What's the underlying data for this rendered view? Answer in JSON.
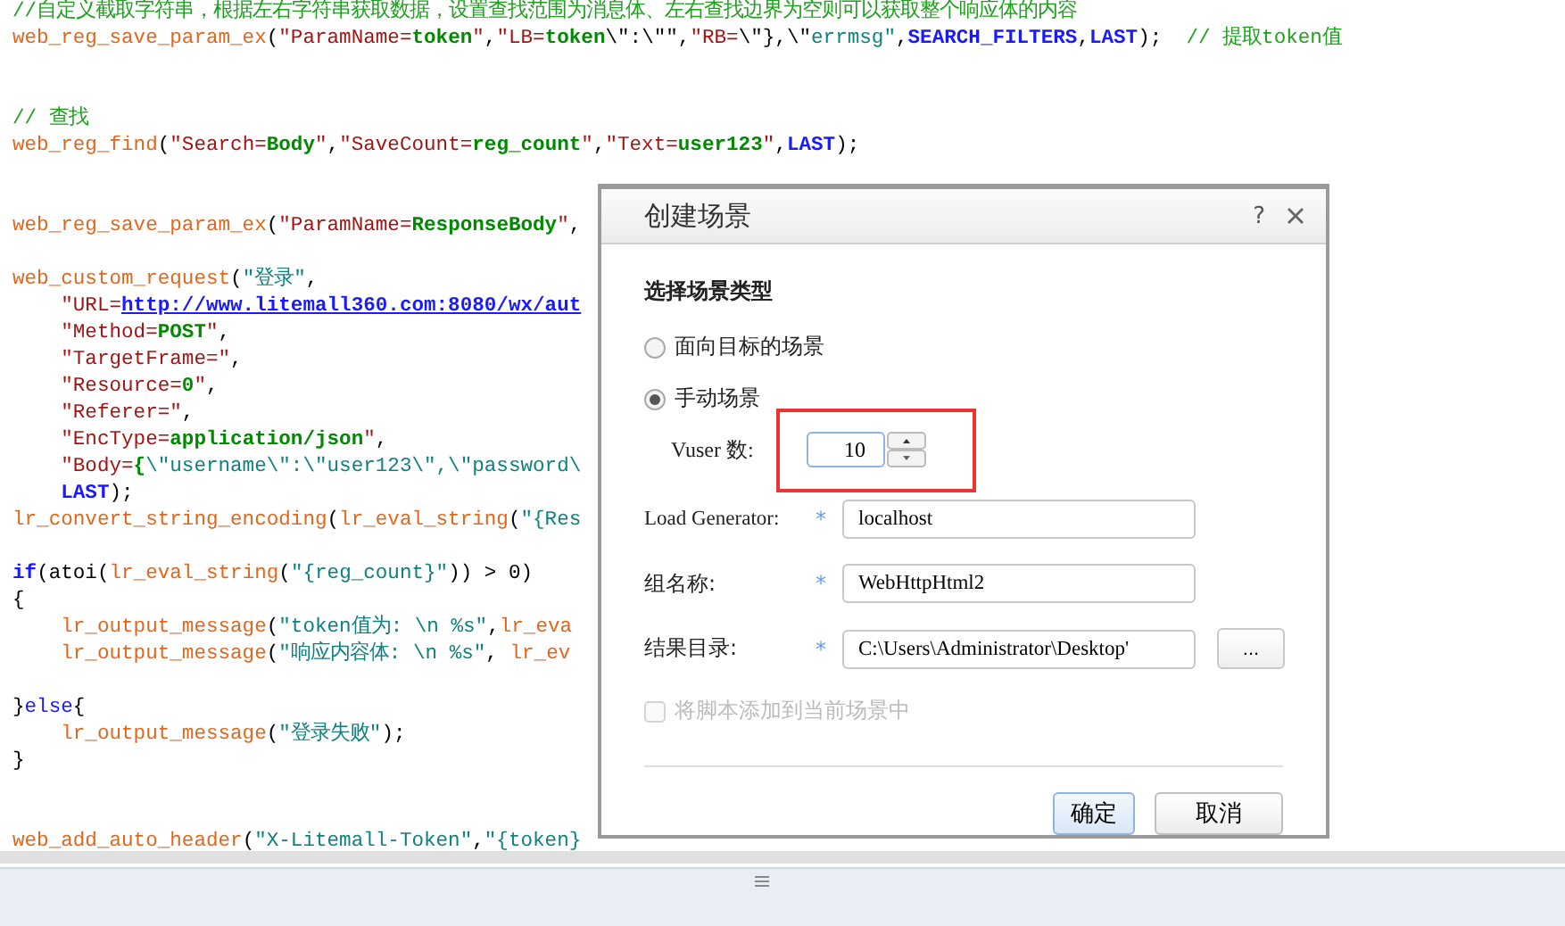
{
  "editor": {
    "lines": [
      {
        "kind": "code",
        "tokens": [
          {
            "kind": "c",
            "text": "//自定义截取字符串，根据左右字符串获取数据，设置查找范围为消息体、左右查找边界为空则可以获取整个响应体的内容"
          }
        ]
      },
      {
        "kind": "code",
        "tokens": [
          {
            "kind": "f",
            "text": "web_reg_save_param_ex"
          },
          {
            "kind": "p",
            "text": "("
          },
          {
            "kind": "s",
            "text": "\"ParamName="
          },
          {
            "kind": "v",
            "text": "token"
          },
          {
            "kind": "s",
            "text": "\""
          },
          {
            "kind": "p",
            "text": ","
          },
          {
            "kind": "s",
            "text": "\"LB="
          },
          {
            "kind": "v",
            "text": "token"
          },
          {
            "kind": "p",
            "text": "\\\":\\\"\""
          },
          {
            "kind": "p",
            "text": ","
          },
          {
            "kind": "s",
            "text": "\"RB="
          },
          {
            "kind": "p",
            "text": "\\\"},\\\""
          },
          {
            "kind": "t",
            "text": "errmsg\""
          },
          {
            "kind": "p",
            "text": ","
          },
          {
            "kind": "k",
            "text": "SEARCH_FILTERS"
          },
          {
            "kind": "p",
            "text": ","
          },
          {
            "kind": "k",
            "text": "LAST"
          },
          {
            "kind": "p",
            "text": ");  "
          },
          {
            "kind": "c",
            "text": "// 提取token值"
          }
        ]
      },
      {
        "kind": "blank"
      },
      {
        "kind": "blank"
      },
      {
        "kind": "code",
        "tokens": [
          {
            "kind": "c",
            "text": "// 查找"
          }
        ]
      },
      {
        "kind": "code",
        "tokens": [
          {
            "kind": "f",
            "text": "web_reg_find"
          },
          {
            "kind": "p",
            "text": "("
          },
          {
            "kind": "s",
            "text": "\"Search="
          },
          {
            "kind": "v",
            "text": "Body"
          },
          {
            "kind": "s",
            "text": "\""
          },
          {
            "kind": "p",
            "text": ","
          },
          {
            "kind": "s",
            "text": "\"SaveCount="
          },
          {
            "kind": "v",
            "text": "reg_count"
          },
          {
            "kind": "s",
            "text": "\""
          },
          {
            "kind": "p",
            "text": ","
          },
          {
            "kind": "s",
            "text": "\"Text="
          },
          {
            "kind": "v",
            "text": "user123"
          },
          {
            "kind": "s",
            "text": "\""
          },
          {
            "kind": "p",
            "text": ","
          },
          {
            "kind": "k",
            "text": "LAST"
          },
          {
            "kind": "p",
            "text": ");"
          }
        ]
      },
      {
        "kind": "blank"
      },
      {
        "kind": "blank"
      },
      {
        "kind": "code",
        "tokens": [
          {
            "kind": "f",
            "text": "web_reg_save_param_ex"
          },
          {
            "kind": "p",
            "text": "("
          },
          {
            "kind": "s",
            "text": "\"ParamName="
          },
          {
            "kind": "v",
            "text": "ResponseBody"
          },
          {
            "kind": "s",
            "text": "\""
          },
          {
            "kind": "p",
            "text": ","
          }
        ]
      },
      {
        "kind": "blank"
      },
      {
        "kind": "code",
        "tokens": [
          {
            "kind": "f",
            "text": "web_custom_request"
          },
          {
            "kind": "p",
            "text": "("
          },
          {
            "kind": "t",
            "text": "\"登录\""
          },
          {
            "kind": "p",
            "text": ","
          }
        ]
      },
      {
        "kind": "code",
        "tokens": [
          {
            "kind": "s",
            "text": "    \"URL="
          },
          {
            "kind": "u",
            "text": "http://www.litemall360.com:8080/wx/aut"
          }
        ]
      },
      {
        "kind": "code",
        "tokens": [
          {
            "kind": "s",
            "text": "    \"Method="
          },
          {
            "kind": "v",
            "text": "POST"
          },
          {
            "kind": "s",
            "text": "\""
          },
          {
            "kind": "p",
            "text": ","
          }
        ]
      },
      {
        "kind": "code",
        "tokens": [
          {
            "kind": "s",
            "text": "    \"TargetFrame=\""
          },
          {
            "kind": "p",
            "text": ","
          }
        ]
      },
      {
        "kind": "code",
        "tokens": [
          {
            "kind": "s",
            "text": "    \"Resource="
          },
          {
            "kind": "v",
            "text": "0"
          },
          {
            "kind": "s",
            "text": "\""
          },
          {
            "kind": "p",
            "text": ","
          }
        ]
      },
      {
        "kind": "code",
        "tokens": [
          {
            "kind": "s",
            "text": "    \"Referer=\""
          },
          {
            "kind": "p",
            "text": ","
          }
        ]
      },
      {
        "kind": "code",
        "tokens": [
          {
            "kind": "s",
            "text": "    \"EncType="
          },
          {
            "kind": "v",
            "text": "application/json"
          },
          {
            "kind": "s",
            "text": "\""
          },
          {
            "kind": "p",
            "text": ","
          }
        ]
      },
      {
        "kind": "code",
        "tokens": [
          {
            "kind": "s",
            "text": "    \"Body="
          },
          {
            "kind": "v",
            "text": "{"
          },
          {
            "kind": "t",
            "text": "\\\"username\\\":\\\"user123\\\",\\\"password\\"
          }
        ]
      },
      {
        "kind": "code",
        "tokens": [
          {
            "kind": "k",
            "text": "    LAST"
          },
          {
            "kind": "p",
            "text": ");"
          }
        ]
      },
      {
        "kind": "code",
        "tokens": [
          {
            "kind": "f",
            "text": "lr_convert_string_encoding"
          },
          {
            "kind": "p",
            "text": "("
          },
          {
            "kind": "f",
            "text": "lr_eval_string"
          },
          {
            "kind": "p",
            "text": "("
          },
          {
            "kind": "t",
            "text": "\"{Res"
          }
        ]
      },
      {
        "kind": "blank"
      },
      {
        "kind": "code",
        "tokens": [
          {
            "kind": "k",
            "text": "if"
          },
          {
            "kind": "p",
            "text": "(atoi("
          },
          {
            "kind": "f",
            "text": "lr_eval_string"
          },
          {
            "kind": "p",
            "text": "("
          },
          {
            "kind": "t",
            "text": "\"{reg_count}\""
          },
          {
            "kind": "p",
            "text": ")) > 0)"
          }
        ]
      },
      {
        "kind": "code",
        "tokens": [
          {
            "kind": "p",
            "text": "{"
          }
        ]
      },
      {
        "kind": "code",
        "tokens": [
          {
            "kind": "f",
            "text": "    lr_output_message"
          },
          {
            "kind": "p",
            "text": "("
          },
          {
            "kind": "t",
            "text": "\"token值为: \\n %s\""
          },
          {
            "kind": "p",
            "text": ","
          },
          {
            "kind": "f",
            "text": "lr_eva"
          }
        ]
      },
      {
        "kind": "code",
        "tokens": [
          {
            "kind": "f",
            "text": "    lr_output_message"
          },
          {
            "kind": "p",
            "text": "("
          },
          {
            "kind": "t",
            "text": "\"响应内容体: \\n %s\""
          },
          {
            "kind": "p",
            "text": ", "
          },
          {
            "kind": "f",
            "text": "lr_ev"
          }
        ]
      },
      {
        "kind": "blank"
      },
      {
        "kind": "code",
        "tokens": [
          {
            "kind": "p",
            "text": "}"
          },
          {
            "kind": "e",
            "text": "else"
          },
          {
            "kind": "p",
            "text": "{"
          }
        ]
      },
      {
        "kind": "code",
        "tokens": [
          {
            "kind": "f",
            "text": "    lr_output_message"
          },
          {
            "kind": "p",
            "text": "("
          },
          {
            "kind": "t",
            "text": "\"登录失败\""
          },
          {
            "kind": "p",
            "text": ");"
          }
        ]
      },
      {
        "kind": "code",
        "tokens": [
          {
            "kind": "p",
            "text": "}"
          }
        ]
      },
      {
        "kind": "blank"
      },
      {
        "kind": "blank"
      },
      {
        "kind": "code",
        "tokens": [
          {
            "kind": "f",
            "text": "web_add_auto_header"
          },
          {
            "kind": "p",
            "text": "("
          },
          {
            "kind": "t",
            "text": "\"X-Litemall-Token\""
          },
          {
            "kind": "p",
            "text": ","
          },
          {
            "kind": "t",
            "text": "\"{token}"
          }
        ]
      }
    ]
  },
  "dialog": {
    "title": "创建场景",
    "help": "?",
    "section_title": "选择场景类型",
    "scenario_types": [
      {
        "label": "面向目标的场景",
        "selected": false
      },
      {
        "label": "手动场景",
        "selected": true
      }
    ],
    "vuser": {
      "label": "Vuser 数:",
      "value": "10",
      "highlighted": true
    },
    "fields": [
      {
        "label": "Load Generator:",
        "required": "*",
        "value": "localhost",
        "kind": "text"
      },
      {
        "label": "组名称:",
        "required": "*",
        "value": "WebHttpHtml2",
        "kind": "text"
      },
      {
        "label": "结果目录:",
        "required": "*",
        "value": "C:\\Users\\Administrator\\Desktop'",
        "kind": "browse",
        "browse_label": "..."
      }
    ],
    "add_to_scenario": {
      "label": "将脚本添加到当前场景中",
      "checked": false,
      "disabled": true
    },
    "buttons": [
      {
        "label": "确定",
        "default": true
      },
      {
        "label": "取消",
        "default": false
      }
    ]
  }
}
